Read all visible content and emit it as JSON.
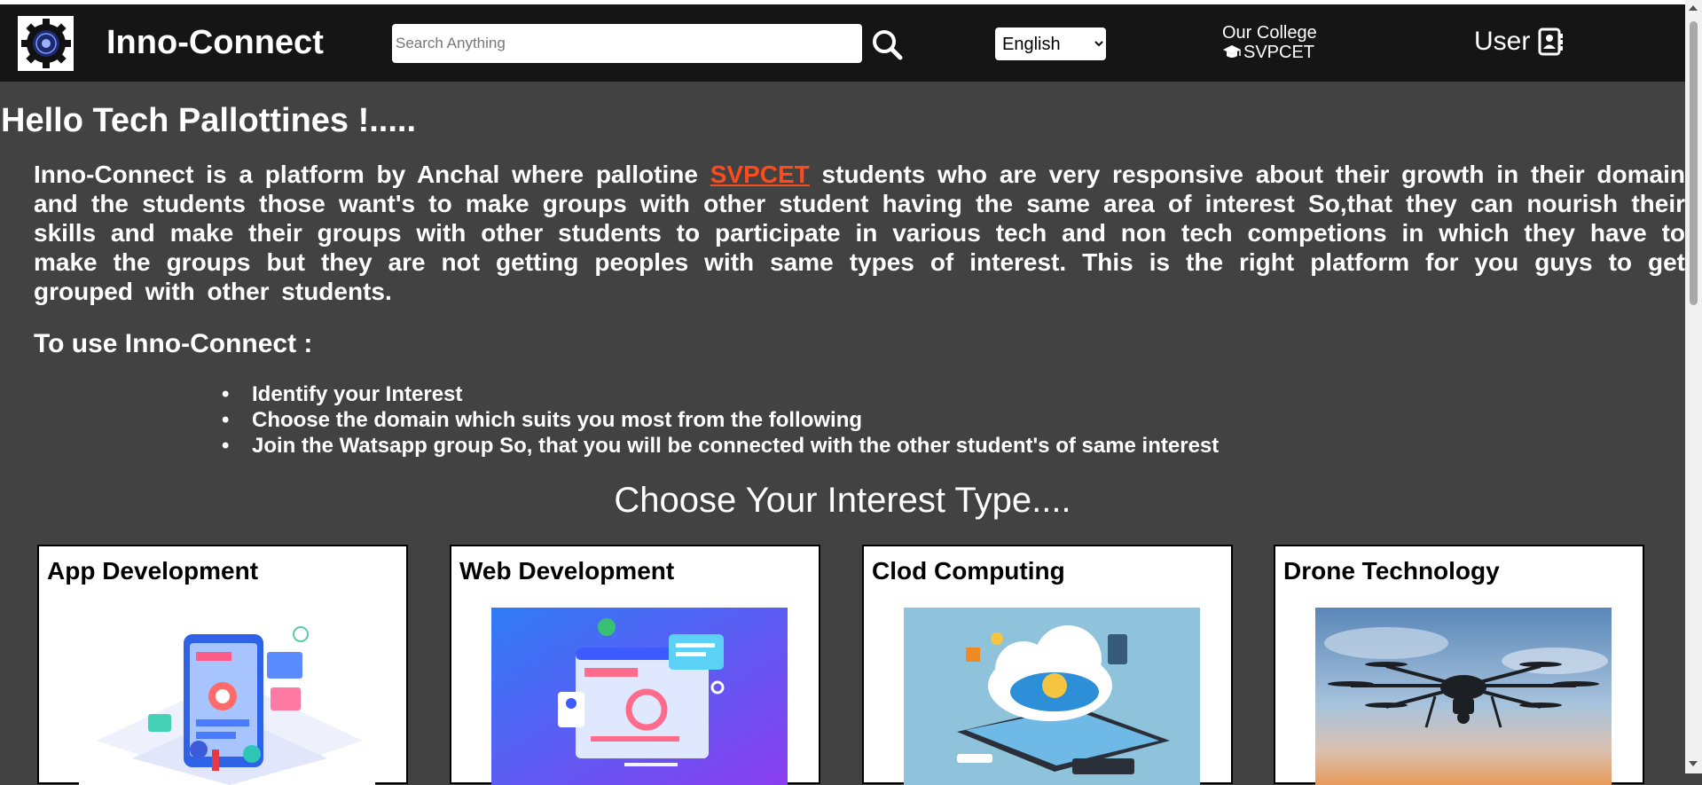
{
  "header": {
    "brand": "Inno-Connect",
    "search_placeholder": "Search Anything",
    "language_options": [
      "English"
    ],
    "language_selected": "English",
    "college_label": "Our College",
    "college_name": "SVPCET",
    "user_label": "User"
  },
  "main": {
    "greeting": "Hello Tech Pallottines !.....",
    "intro_before": "Inno-Connect is a platform by Anchal where pallotine ",
    "intro_highlight": "SVPCET",
    "intro_after": " students who are very responsive about their growth in their domain and the students those want's to make groups with other student having the same area of interest So,that they can nourish their skills and make their groups with other students to participate in various tech and non tech competions in which they have to make the groups but they are not getting peoples with same types of interest. This is the right platform for you guys to get grouped with other students.",
    "howto_title": "To use Inno-Connect :",
    "steps": [
      "Identify your Interest",
      "Choose the domain which suits you most from the following",
      "Join the Watsapp group So, that you will be connected with the other student's of same interest"
    ],
    "choose_title": "Choose Your Interest Type....",
    "cards": [
      {
        "title": "App Development",
        "icon": "app-development-illustration"
      },
      {
        "title": "Web Development",
        "icon": "web-development-illustration"
      },
      {
        "title": "Clod Computing",
        "icon": "cloud-computing-illustration"
      },
      {
        "title": "Drone Technology",
        "icon": "drone-photo"
      }
    ]
  },
  "colors": {
    "navbar": "#151515",
    "page_bg": "#424242",
    "highlight": "#ff4a1c"
  }
}
